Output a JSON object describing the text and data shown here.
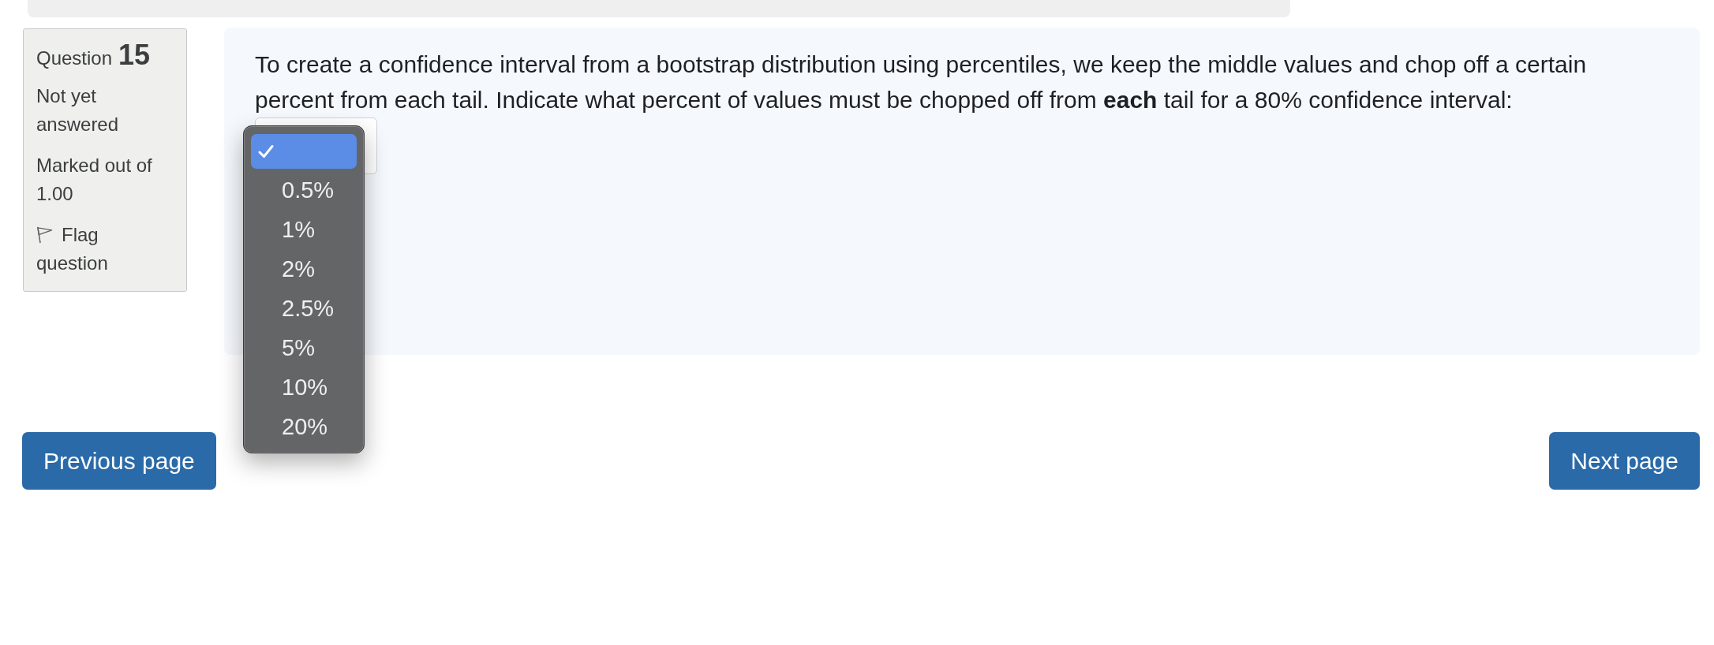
{
  "question_info": {
    "label": "Question",
    "number": "15",
    "state": "Not yet answered",
    "grade": "Marked out of 1.00",
    "flag": {
      "label": "Flag question",
      "flagged": false
    }
  },
  "question": {
    "text": "To create a confidence interval from a bootstrap distribution using percentiles, we keep the middle values and chop off a certain percent from each tail. Indicate what percent of values must be chopped off from **each** tail for a 80% confidence interval:"
  },
  "dropdown": {
    "expanded": true,
    "options": [
      {
        "selected": true
      },
      {
        "label": "0.5%",
        "selected": false
      },
      {
        "label": "1%",
        "selected": false
      },
      {
        "label": "2%",
        "selected": false
      },
      {
        "label": "2.5%",
        "selected": false
      },
      {
        "label": "5%",
        "selected": false
      },
      {
        "label": "10%",
        "selected": false
      },
      {
        "label": "20%",
        "selected": false
      }
    ]
  },
  "navigation": {
    "previous": "Previous page",
    "next": "Next page"
  }
}
